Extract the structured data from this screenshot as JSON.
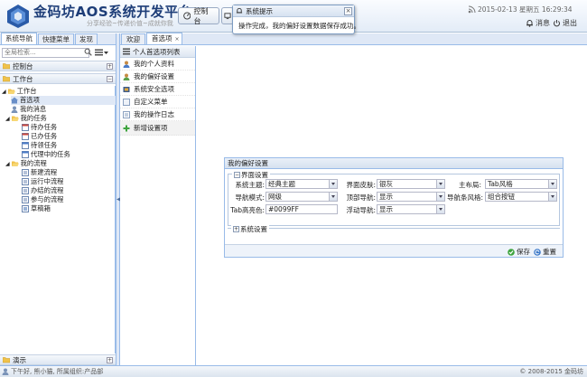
{
  "header": {
    "title": "金码坊AOS系统开发平台",
    "slogan": "分享经验~传递价值~成就你我",
    "console_button": "控制台",
    "datetime": "2015-02-13 星期五 16:29:34",
    "messages_label": "消息",
    "exit_label": "退出"
  },
  "notification": {
    "title": "系统提示",
    "message": "操作完成，我的偏好设置数据保存成功。"
  },
  "left_panel": {
    "tabs": [
      "系统导航",
      "快捷菜单",
      "发现"
    ],
    "search_placeholder": "全局检索...",
    "accordion": {
      "console": "控制台",
      "workbench": "工作台",
      "demo": "演示"
    },
    "tree": {
      "root": "工作台",
      "home": "首选项",
      "my_messages": "我的消息",
      "my_tasks": "我的任务",
      "tasks": [
        "待办任务",
        "已办任务",
        "待领任务",
        "代理中的任务"
      ],
      "my_flows": "我的流程",
      "flows": [
        "新建流程",
        "运行中流程",
        "办结的流程",
        "参与的流程",
        "草稿箱"
      ]
    }
  },
  "center": {
    "tabs": [
      "欢迎",
      "首选项"
    ]
  },
  "pref_list": {
    "header": "个人首选项列表",
    "items": [
      "我的个人资料",
      "我的偏好设置",
      "系统安全选项",
      "自定义菜单",
      "我的操作日志"
    ],
    "new_item": "新增设置项"
  },
  "form": {
    "title": "我的偏好设置",
    "ui_section": "界面设置",
    "sys_section": "系统设置",
    "fields": {
      "theme_label": "系统主题:",
      "theme_value": "经典主题",
      "skin_label": "界面皮肤:",
      "skin_value": "银灰",
      "layout_label": "主布局:",
      "layout_value": "Tab风格",
      "nav_mode_label": "导航模式:",
      "nav_mode_value": "网级",
      "top_nav_label": "顶部导航:",
      "top_nav_value": "显示",
      "nav_bar_style_label": "导航条风格:",
      "nav_bar_style_value": "组合按钮",
      "tab_color_label": "Tab高亮色:",
      "tab_color_value": "#0099FF",
      "float_nav_label": "浮动导航:",
      "float_nav_value": "显示"
    },
    "save_label": "保存",
    "reset_label": "重置"
  },
  "statusbar": {
    "left": "下午好, 熊小猫, 所属组织:产品部",
    "copyright": "© 2008-2015 金码坊"
  },
  "colors": {
    "accent": "#1d3d78",
    "border": "#99bbe8",
    "tab_bg": "#dfe8f6"
  }
}
